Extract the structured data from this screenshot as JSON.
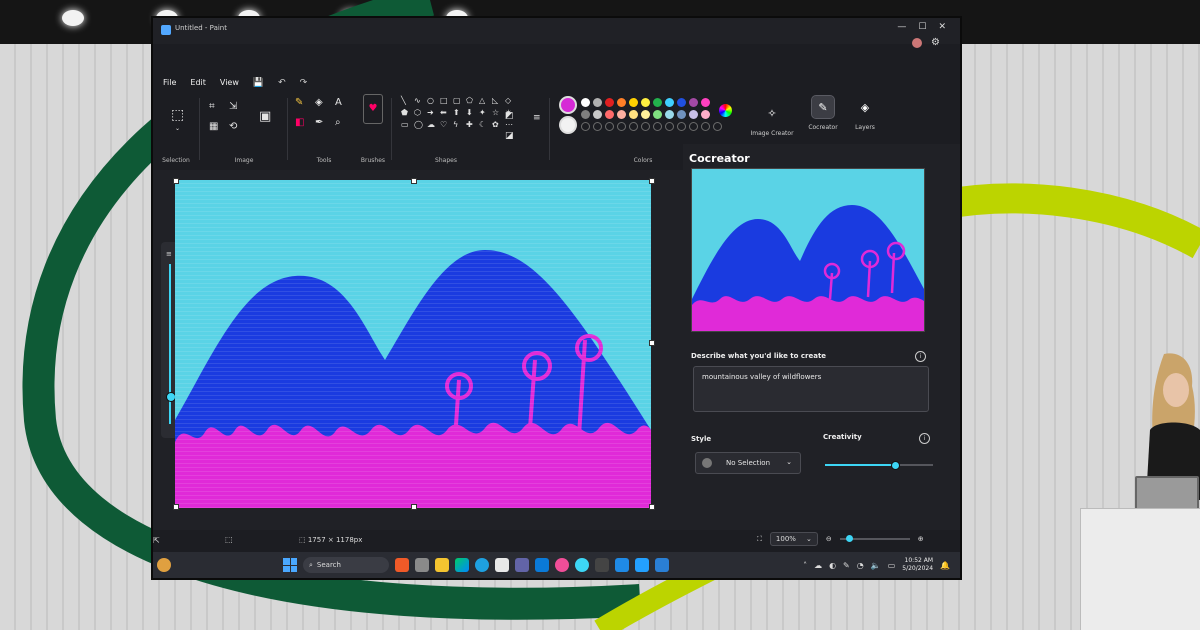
{
  "window": {
    "title": "Untitled - Paint"
  },
  "menu": {
    "file": "File",
    "edit": "Edit",
    "view": "View"
  },
  "ribbon": {
    "groups": {
      "selection": "Selection",
      "image": "Image",
      "tools": "Tools",
      "brushes": "Brushes",
      "shapes": "Shapes",
      "colors": "Colors"
    },
    "image_creator": "Image Creator",
    "cocreator": "Cocreator",
    "layers": "Layers",
    "colors": {
      "primary": "#d62ad6",
      "secondary": "#f2f2f2",
      "row1": [
        "#ffffff",
        "#b0b0b0",
        "#e02020",
        "#ff7f27",
        "#ffd000",
        "#ffef40",
        "#22b14c",
        "#40d0ff",
        "#2050e0",
        "#a349a4",
        "#ff40c0"
      ],
      "row2": [
        "#7f7f7f",
        "#c8c8c8",
        "#ff6a6a",
        "#ffb0a0",
        "#ffe080",
        "#fff09a",
        "#80e080",
        "#99d9ea",
        "#7092be",
        "#c8bfe7",
        "#ffaec9"
      ]
    }
  },
  "cocreator_panel": {
    "title": "Cocreator",
    "describe_label": "Describe what you'd like to create",
    "prompt_value": "mountainous valley of wildflowers",
    "style_label": "Style",
    "style_value": "No Selection",
    "creativity_label": "Creativity",
    "creativity_level": 0.65
  },
  "status": {
    "canvas_size": "1757 × 1178px",
    "zoom": "100%"
  },
  "taskbar": {
    "search_label": "Search",
    "time": "10:52 AM",
    "date": "5/20/2024"
  },
  "palette": {
    "sky": "#5ad3e6",
    "mountain": "#1a3be0",
    "flowers": "#e02ad8",
    "accent": "#3dd6f5"
  }
}
